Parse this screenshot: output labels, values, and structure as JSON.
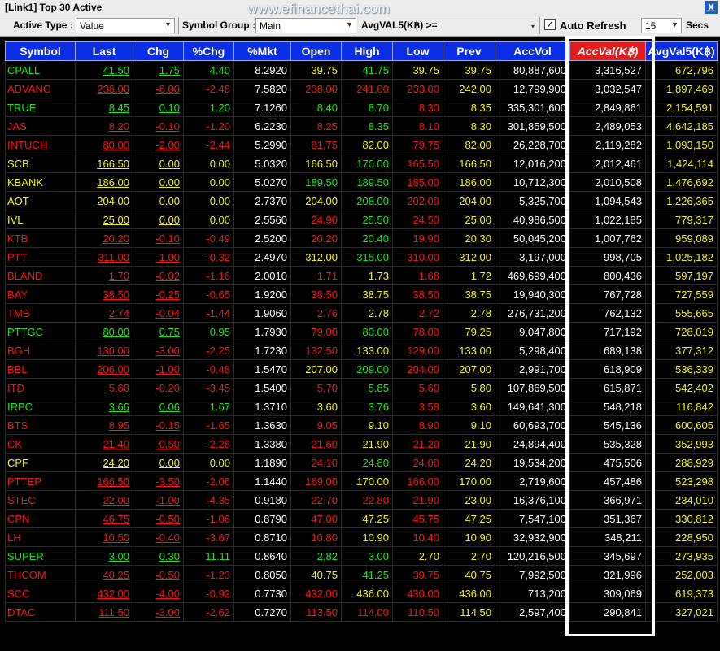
{
  "window": {
    "title": "[Link1] Top 30 Active",
    "watermark": "www.efinancethai.com",
    "close_label": "X"
  },
  "toolbar": {
    "active_type_label": "Active Type :",
    "active_type_value": "Value",
    "symbol_group_label": "Symbol Group :",
    "symbol_group_value": "Main",
    "avgval_label": "AvgVAL5(K฿) >=",
    "avgval_value": "",
    "auto_refresh_label": "Auto Refresh",
    "auto_refresh_checked": "✓",
    "refresh_seconds": "15",
    "secs_label": "Secs"
  },
  "columns": [
    "Symbol",
    "Last",
    "Chg",
    "%Chg",
    "%Mkt",
    "Open",
    "High",
    "Low",
    "Prev",
    "AccVol",
    "AccVal(K฿)",
    "AvgVal5(K฿)"
  ],
  "sorted_column_index": 10,
  "colors": {
    "up": "#22e322",
    "down": "#f51717",
    "unchanged": "#f2f21a",
    "header": "#0a2de6",
    "sorted_header": "#e21c1c"
  },
  "rows": [
    {
      "symbol": "CPALL",
      "last": "41.50",
      "chg": "1.75",
      "pchg": "4.40",
      "pmkt": "8.2920",
      "open": "39.75",
      "high": "41.75",
      "low": "39.75",
      "prev": "39.75",
      "accvol": "80,887,600",
      "accval": "3,316,527",
      "avgval5": "672,796",
      "dir": "up",
      "c_open": "un",
      "c_high": "up",
      "c_low": "un"
    },
    {
      "symbol": "ADVANC",
      "last": "236.00",
      "chg": "-6.00",
      "pchg": "-2.48",
      "pmkt": "7.5820",
      "open": "238.00",
      "high": "241.00",
      "low": "233.00",
      "prev": "242.00",
      "accvol": "12,799,900",
      "accval": "3,032,547",
      "avgval5": "1,897,469",
      "dir": "dn",
      "c_open": "dn",
      "c_high": "dn",
      "c_low": "dn"
    },
    {
      "symbol": "TRUE",
      "last": "8.45",
      "chg": "0.10",
      "pchg": "1.20",
      "pmkt": "7.1260",
      "open": "8.40",
      "high": "8.70",
      "low": "8.30",
      "prev": "8.35",
      "accvol": "335,301,600",
      "accval": "2,849,861",
      "avgval5": "2,154,591",
      "dir": "up",
      "c_open": "up",
      "c_high": "up",
      "c_low": "dn"
    },
    {
      "symbol": "JAS",
      "last": "8.20",
      "chg": "-0.10",
      "pchg": "-1.20",
      "pmkt": "6.2230",
      "open": "8.25",
      "high": "8.35",
      "low": "8.10",
      "prev": "8.30",
      "accvol": "301,859,500",
      "accval": "2,489,053",
      "avgval5": "4,642,185",
      "dir": "dn",
      "c_open": "dn",
      "c_high": "up",
      "c_low": "dn"
    },
    {
      "symbol": "INTUCH",
      "last": "80.00",
      "chg": "-2.00",
      "pchg": "-2.44",
      "pmkt": "5.2990",
      "open": "81.75",
      "high": "82.00",
      "low": "79.75",
      "prev": "82.00",
      "accvol": "26,228,700",
      "accval": "2,119,282",
      "avgval5": "1,093,150",
      "dir": "dn",
      "c_open": "dn",
      "c_high": "un",
      "c_low": "dn"
    },
    {
      "symbol": "SCB",
      "last": "166.50",
      "chg": "0.00",
      "pchg": "0.00",
      "pmkt": "5.0320",
      "open": "166.50",
      "high": "170.00",
      "low": "165.50",
      "prev": "166.50",
      "accvol": "12,016,200",
      "accval": "2,012,461",
      "avgval5": "1,424,114",
      "dir": "un",
      "c_open": "un",
      "c_high": "up",
      "c_low": "dn"
    },
    {
      "symbol": "KBANK",
      "last": "186.00",
      "chg": "0.00",
      "pchg": "0.00",
      "pmkt": "5.0270",
      "open": "189.50",
      "high": "189.50",
      "low": "185.00",
      "prev": "186.00",
      "accvol": "10,712,300",
      "accval": "2,010,508",
      "avgval5": "1,476,692",
      "dir": "un",
      "c_open": "up",
      "c_high": "up",
      "c_low": "dn"
    },
    {
      "symbol": "AOT",
      "last": "204.00",
      "chg": "0.00",
      "pchg": "0.00",
      "pmkt": "2.7370",
      "open": "204.00",
      "high": "208.00",
      "low": "202.00",
      "prev": "204.00",
      "accvol": "5,325,700",
      "accval": "1,094,543",
      "avgval5": "1,226,365",
      "dir": "un",
      "c_open": "un",
      "c_high": "up",
      "c_low": "dn"
    },
    {
      "symbol": "IVL",
      "last": "25.00",
      "chg": "0.00",
      "pchg": "0.00",
      "pmkt": "2.5560",
      "open": "24.90",
      "high": "25.50",
      "low": "24.50",
      "prev": "25.00",
      "accvol": "40,986,500",
      "accval": "1,022,185",
      "avgval5": "779,317",
      "dir": "un",
      "c_open": "dn",
      "c_high": "up",
      "c_low": "dn"
    },
    {
      "symbol": "KTB",
      "last": "20.20",
      "chg": "-0.10",
      "pchg": "-0.49",
      "pmkt": "2.5200",
      "open": "20.20",
      "high": "20.40",
      "low": "19.90",
      "prev": "20.30",
      "accvol": "50,045,200",
      "accval": "1,007,762",
      "avgval5": "959,089",
      "dir": "dn",
      "c_open": "dn",
      "c_high": "up",
      "c_low": "dn"
    },
    {
      "symbol": "PTT",
      "last": "311.00",
      "chg": "-1.00",
      "pchg": "-0.32",
      "pmkt": "2.4970",
      "open": "312.00",
      "high": "315.00",
      "low": "310.00",
      "prev": "312.00",
      "accvol": "3,197,000",
      "accval": "998,705",
      "avgval5": "1,025,182",
      "dir": "dn",
      "c_open": "un",
      "c_high": "up",
      "c_low": "dn"
    },
    {
      "symbol": "BLAND",
      "last": "1.70",
      "chg": "-0.02",
      "pchg": "-1.16",
      "pmkt": "2.0010",
      "open": "1.71",
      "high": "1.73",
      "low": "1.68",
      "prev": "1.72",
      "accvol": "469,699,400",
      "accval": "800,436",
      "avgval5": "597,197",
      "dir": "dn",
      "c_open": "dn",
      "c_high": "un",
      "c_low": "dn"
    },
    {
      "symbol": "BAY",
      "last": "38.50",
      "chg": "-0.25",
      "pchg": "-0.65",
      "pmkt": "1.9200",
      "open": "38.50",
      "high": "38.75",
      "low": "38.50",
      "prev": "38.75",
      "accvol": "19,940,300",
      "accval": "767,728",
      "avgval5": "727,559",
      "dir": "dn",
      "c_open": "dn",
      "c_high": "un",
      "c_low": "dn"
    },
    {
      "symbol": "TMB",
      "last": "2.74",
      "chg": "-0.04",
      "pchg": "-1.44",
      "pmkt": "1.9060",
      "open": "2.76",
      "high": "2.78",
      "low": "2.72",
      "prev": "2.78",
      "accvol": "276,731,200",
      "accval": "762,132",
      "avgval5": "555,665",
      "dir": "dn",
      "c_open": "dn",
      "c_high": "un",
      "c_low": "dn"
    },
    {
      "symbol": "PTTGC",
      "last": "80.00",
      "chg": "0.75",
      "pchg": "0.95",
      "pmkt": "1.7930",
      "open": "79.00",
      "high": "80.00",
      "low": "78.00",
      "prev": "79.25",
      "accvol": "9,047,800",
      "accval": "717,192",
      "avgval5": "728,019",
      "dir": "up",
      "c_open": "dn",
      "c_high": "up",
      "c_low": "dn"
    },
    {
      "symbol": "BGH",
      "last": "130.00",
      "chg": "-3.00",
      "pchg": "-2.25",
      "pmkt": "1.7230",
      "open": "132.50",
      "high": "133.00",
      "low": "129.00",
      "prev": "133.00",
      "accvol": "5,298,400",
      "accval": "689,138",
      "avgval5": "377,312",
      "dir": "dn",
      "c_open": "dn",
      "c_high": "un",
      "c_low": "dn"
    },
    {
      "symbol": "BBL",
      "last": "206.00",
      "chg": "-1.00",
      "pchg": "-0.48",
      "pmkt": "1.5470",
      "open": "207.00",
      "high": "209.00",
      "low": "204.00",
      "prev": "207.00",
      "accvol": "2,991,700",
      "accval": "618,909",
      "avgval5": "536,339",
      "dir": "dn",
      "c_open": "un",
      "c_high": "up",
      "c_low": "dn"
    },
    {
      "symbol": "ITD",
      "last": "5.60",
      "chg": "-0.20",
      "pchg": "-3.45",
      "pmkt": "1.5400",
      "open": "5.70",
      "high": "5.85",
      "low": "5.60",
      "prev": "5.80",
      "accvol": "107,869,500",
      "accval": "615,871",
      "avgval5": "542,402",
      "dir": "dn",
      "c_open": "dn",
      "c_high": "up",
      "c_low": "dn"
    },
    {
      "symbol": "IRPC",
      "last": "3.66",
      "chg": "0.06",
      "pchg": "1.67",
      "pmkt": "1.3710",
      "open": "3.60",
      "high": "3.76",
      "low": "3.58",
      "prev": "3.60",
      "accvol": "149,641,300",
      "accval": "548,218",
      "avgval5": "116,842",
      "dir": "up",
      "c_open": "un",
      "c_high": "up",
      "c_low": "dn"
    },
    {
      "symbol": "BTS",
      "last": "8.95",
      "chg": "-0.15",
      "pchg": "-1.65",
      "pmkt": "1.3630",
      "open": "9.05",
      "high": "9.10",
      "low": "8.90",
      "prev": "9.10",
      "accvol": "60,693,700",
      "accval": "545,136",
      "avgval5": "600,605",
      "dir": "dn",
      "c_open": "dn",
      "c_high": "un",
      "c_low": "dn"
    },
    {
      "symbol": "CK",
      "last": "21.40",
      "chg": "-0.50",
      "pchg": "-2.28",
      "pmkt": "1.3380",
      "open": "21.60",
      "high": "21.90",
      "low": "21.20",
      "prev": "21.90",
      "accvol": "24,894,400",
      "accval": "535,328",
      "avgval5": "352,993",
      "dir": "dn",
      "c_open": "dn",
      "c_high": "un",
      "c_low": "dn"
    },
    {
      "symbol": "CPF",
      "last": "24.20",
      "chg": "0.00",
      "pchg": "0.00",
      "pmkt": "1.1890",
      "open": "24.10",
      "high": "24.80",
      "low": "24.00",
      "prev": "24.20",
      "accvol": "19,534,200",
      "accval": "475,506",
      "avgval5": "288,929",
      "dir": "un",
      "c_open": "dn",
      "c_high": "up",
      "c_low": "dn"
    },
    {
      "symbol": "PTTEP",
      "last": "166.50",
      "chg": "-3.50",
      "pchg": "-2.06",
      "pmkt": "1.1440",
      "open": "169.00",
      "high": "170.00",
      "low": "166.00",
      "prev": "170.00",
      "accvol": "2,719,600",
      "accval": "457,486",
      "avgval5": "523,298",
      "dir": "dn",
      "c_open": "dn",
      "c_high": "un",
      "c_low": "dn"
    },
    {
      "symbol": "STEC",
      "last": "22.00",
      "chg": "-1.00",
      "pchg": "-4.35",
      "pmkt": "0.9180",
      "open": "22.70",
      "high": "22.80",
      "low": "21.90",
      "prev": "23.00",
      "accvol": "16,376,100",
      "accval": "366,971",
      "avgval5": "234,010",
      "dir": "dn",
      "c_open": "dn",
      "c_high": "dn",
      "c_low": "dn"
    },
    {
      "symbol": "CPN",
      "last": "46.75",
      "chg": "-0.50",
      "pchg": "-1.06",
      "pmkt": "0.8790",
      "open": "47.00",
      "high": "47.25",
      "low": "45.75",
      "prev": "47.25",
      "accvol": "7,547,100",
      "accval": "351,367",
      "avgval5": "330,812",
      "dir": "dn",
      "c_open": "dn",
      "c_high": "un",
      "c_low": "dn"
    },
    {
      "symbol": "LH",
      "last": "10.50",
      "chg": "-0.40",
      "pchg": "-3.67",
      "pmkt": "0.8710",
      "open": "10.80",
      "high": "10.90",
      "low": "10.40",
      "prev": "10.90",
      "accvol": "32,932,900",
      "accval": "348,211",
      "avgval5": "228,950",
      "dir": "dn",
      "c_open": "dn",
      "c_high": "un",
      "c_low": "dn"
    },
    {
      "symbol": "SUPER",
      "last": "3.00",
      "chg": "0.30",
      "pchg": "11.11",
      "pmkt": "0.8640",
      "open": "2.82",
      "high": "3.00",
      "low": "2.70",
      "prev": "2.70",
      "accvol": "120,216,500",
      "accval": "345,697",
      "avgval5": "273,935",
      "dir": "up",
      "c_open": "up",
      "c_high": "up",
      "c_low": "un"
    },
    {
      "symbol": "THCOM",
      "last": "40.25",
      "chg": "-0.50",
      "pchg": "-1.23",
      "pmkt": "0.8050",
      "open": "40.75",
      "high": "41.25",
      "low": "39.75",
      "prev": "40.75",
      "accvol": "7,992,500",
      "accval": "321,996",
      "avgval5": "252,003",
      "dir": "dn",
      "c_open": "un",
      "c_high": "up",
      "c_low": "dn"
    },
    {
      "symbol": "SCC",
      "last": "432.00",
      "chg": "-4.00",
      "pchg": "-0.92",
      "pmkt": "0.7730",
      "open": "432.00",
      "high": "436.00",
      "low": "430.00",
      "prev": "436.00",
      "accvol": "713,200",
      "accval": "309,069",
      "avgval5": "619,373",
      "dir": "dn",
      "c_open": "dn",
      "c_high": "un",
      "c_low": "dn"
    },
    {
      "symbol": "DTAC",
      "last": "111.50",
      "chg": "-3.00",
      "pchg": "-2.62",
      "pmkt": "0.7270",
      "open": "113.50",
      "high": "114.00",
      "low": "110.50",
      "prev": "114.50",
      "accvol": "2,597,400",
      "accval": "290,841",
      "avgval5": "327,021",
      "dir": "dn",
      "c_open": "dn",
      "c_high": "dn",
      "c_low": "dn"
    }
  ]
}
